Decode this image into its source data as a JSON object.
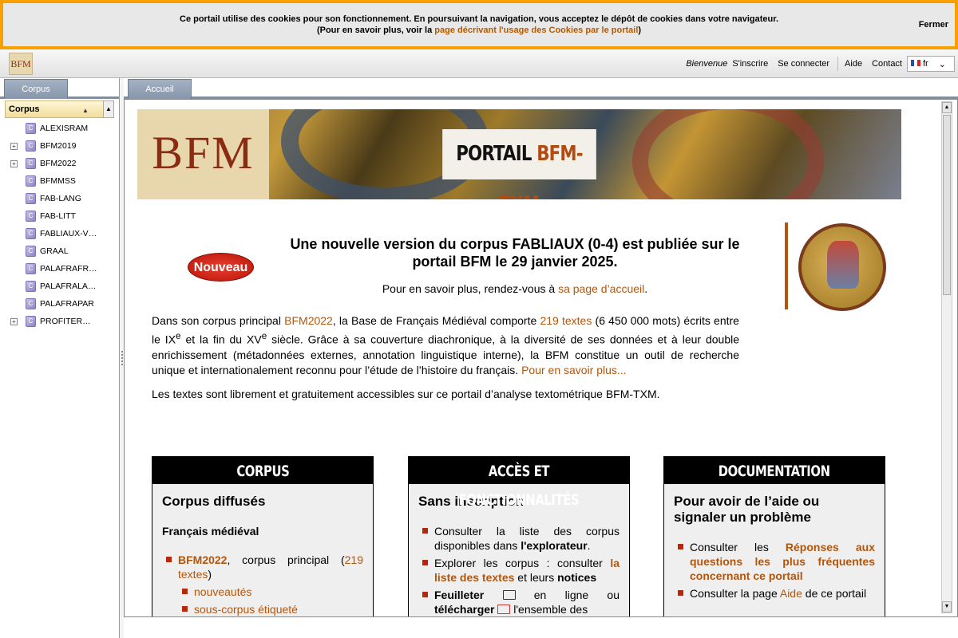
{
  "cookie": {
    "line1": "Ce portail utilise des cookies pour son fonctionnement. En poursuivant la navigation, vous acceptez le dépôt de cookies dans votre navigateur.",
    "line2_prefix": "(Pour en savoir plus, voir la ",
    "line2_link": "page décrivant l'usage des Cookies par le portail",
    "line2_suffix": ")",
    "close": "Fermer"
  },
  "topbar": {
    "logo": "BFM",
    "welcome": "Bienvenue",
    "signup": "S'inscrire",
    "login": "Se connecter",
    "help": "Aide",
    "contact": "Contact",
    "lang": "fr"
  },
  "left": {
    "tab": "Corpus",
    "header": "Corpus",
    "items": [
      {
        "label": "ALEXISRAM",
        "expandable": false
      },
      {
        "label": "BFM2019",
        "expandable": true
      },
      {
        "label": "BFM2022",
        "expandable": true
      },
      {
        "label": "BFMMSS",
        "expandable": false
      },
      {
        "label": "FAB-LANG",
        "expandable": false
      },
      {
        "label": "FAB-LITT",
        "expandable": false
      },
      {
        "label": "FABLIAUX-V…",
        "expandable": false
      },
      {
        "label": "GRAAL",
        "expandable": false
      },
      {
        "label": "PALAFRAFR…",
        "expandable": false
      },
      {
        "label": "PALAFRALA…",
        "expandable": false
      },
      {
        "label": "PALAFRAPAR",
        "expandable": false
      },
      {
        "label": "PROFITER…",
        "expandable": true
      }
    ]
  },
  "main": {
    "tab": "Accueil",
    "banner": {
      "logo": "BFM",
      "title1": "PORTAIL ",
      "title2": "BFM-TXM"
    },
    "nouveau": "Nouveau",
    "headline": "Une nouvelle version du corpus FABLIAUX (0-4) est publiée sur le portail BFM le 29 janvier 2025.",
    "headlink_prefix": "Pour en savoir plus, rendez-vous à ",
    "headlink_link": "sa page d’accueil",
    "headlink_suffix": ".",
    "intro": {
      "p1": "Dans son corpus principal ",
      "link1": "BFM2022",
      "p2": ", la Base de Français Médiéval comporte ",
      "link2": "219 textes",
      "p3": " (6 450 000 mots) écrits entre le IX",
      "sup1": "e",
      "p4": " et la fin du XV",
      "sup2": "e",
      "p5": " siècle. Grâce à sa couverture diachronique, à la diversité de ses données et à leur double enrichissement (métadonnées externes, annotation linguistique interne), la BFM constitue un outil de recherche unique et internationalement reconnu pour l’étude de l’histoire du français. ",
      "link3": "Pour en savoir plus..."
    },
    "intro2": "Les textes sont librement et gratuitement accessibles sur ce portail d’analyse textométrique BFM-TXM.",
    "columns": {
      "corpus": {
        "title": "CORPUS",
        "h3": "Corpus diffusés",
        "h4": "Français médiéval",
        "li1_link": "BFM2022",
        "li1_mid": ", corpus principal (",
        "li1_link2": "219 textes",
        "li1_end": ")",
        "sub1": "nouveautés",
        "sub2": "sous-corpus étiqueté"
      },
      "acces": {
        "title": "ACCÈS ET FONCTIONNALITÉS",
        "h3": "Sans inscription",
        "li1_a": "Consulter la liste des corpus disponibles dans ",
        "li1_b": "l'explorateur",
        "li1_c": ".",
        "li2_a": "Explorer les corpus : consulter ",
        "li2_link": "la liste des textes",
        "li2_b": " et leurs ",
        "li2_c": "notices",
        "li3_a": "Feuilleter",
        "li3_b": " en ligne ou ",
        "li3_c": "télécharger",
        "li3_d": " l'ensemble des"
      },
      "doc": {
        "title": "DOCUMENTATION",
        "h3": "Pour avoir de l’aide ou signaler un problème",
        "li1_a": "Consulter les ",
        "li1_link": "Réponses aux questions les plus fréquentes concernant ce portail",
        "li2_a": "Consulter la page ",
        "li2_link": "Aide",
        "li2_b": " de ce portail"
      }
    }
  }
}
